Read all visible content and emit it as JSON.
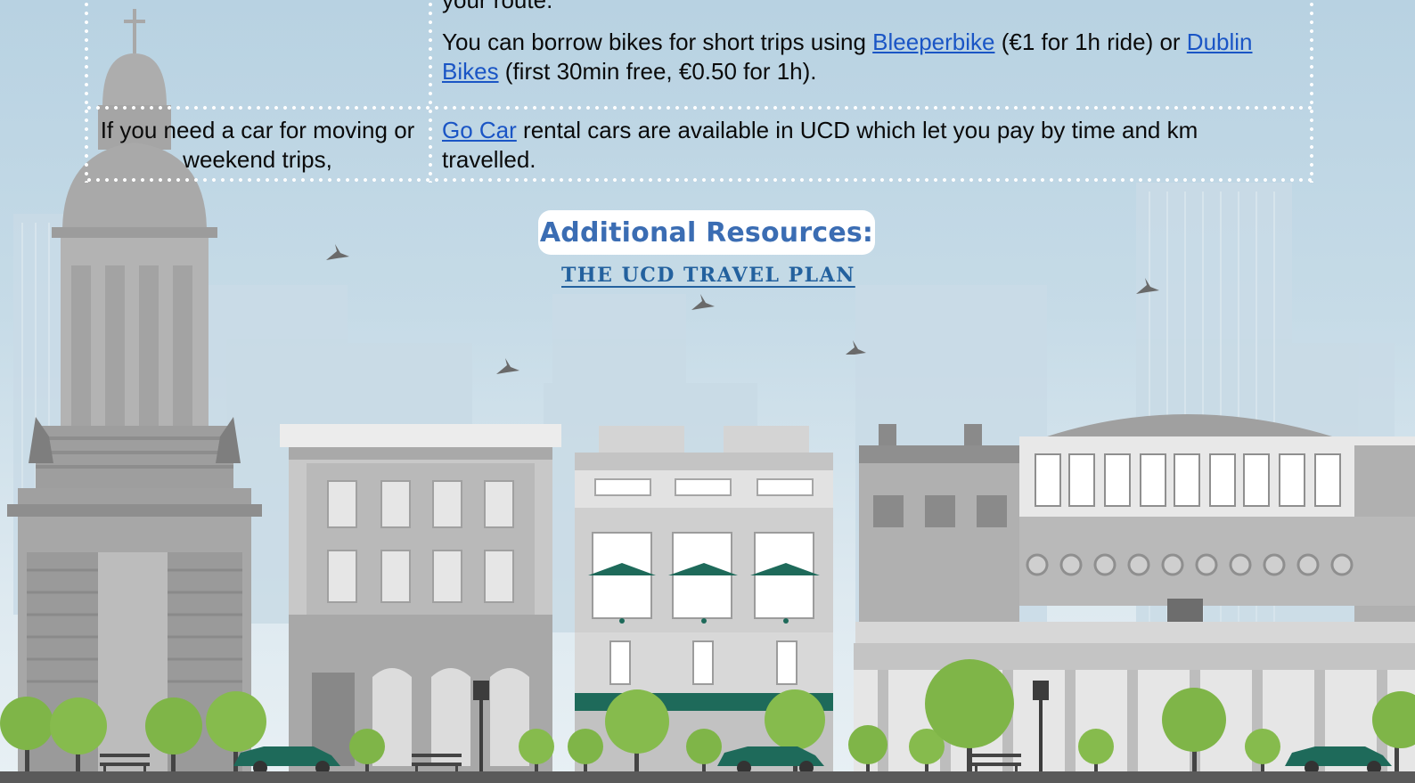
{
  "rows": [
    {
      "left_text": "",
      "right_partial": "your route.",
      "right_prefix": "You can borrow bikes for short trips using ",
      "right_link1": "Bleeperbike",
      "right_mid": " (€1 for 1h ride) or ",
      "right_link2": "Dublin Bikes",
      "right_suffix": " (first 30min free, €0.50 for 1h)."
    },
    {
      "left_text": "If you need a car for moving or weekend trips,",
      "right_link": "Go Car",
      "right_suffix": " rental cars are available in UCD which let you pay by time and km travelled."
    }
  ],
  "resources": {
    "title": "Additional Resources:",
    "travel_plan_link": "THE UCD TRAVEL PLAN"
  },
  "colors": {
    "link": "#1a55c5",
    "resources_title": "#3b6db3",
    "travel_plan": "#23619e",
    "sky_top": "#b8d2e2",
    "sky_bottom": "#e8f0f4",
    "building_grey": "#9a9a9a",
    "tree_green": "#7fb548",
    "car_teal": "#1e6a5a"
  },
  "icons": [
    "bird-icon",
    "tree-icon",
    "car-icon",
    "lamp-post-icon",
    "bench-icon"
  ]
}
